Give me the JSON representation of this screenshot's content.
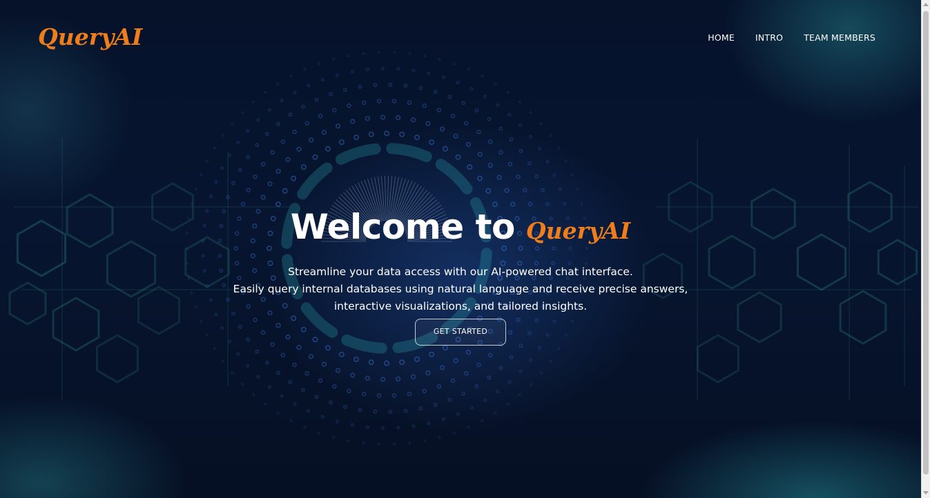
{
  "brand": {
    "name": "QueryAI",
    "color": "#f07d1c"
  },
  "nav": {
    "items": [
      {
        "label": "HOME"
      },
      {
        "label": "INTRO"
      },
      {
        "label": "TEAM MEMBERS"
      }
    ]
  },
  "hero": {
    "title_prefix": "Welcome to",
    "title_brand": "QueryAI",
    "description_lines": [
      "Streamline your data access with our AI-powered chat interface.",
      "Easily query internal databases using natural language and receive precise answers,",
      "interactive visualizations, and tailored insights."
    ],
    "cta_label": "GET STARTED"
  },
  "theme": {
    "background": "#06122a",
    "accent_teal": "#2a8c96",
    "text": "#ffffff"
  },
  "icons": {
    "scroll_up": "chevron-up-icon",
    "scroll_down": "chevron-down-icon"
  }
}
